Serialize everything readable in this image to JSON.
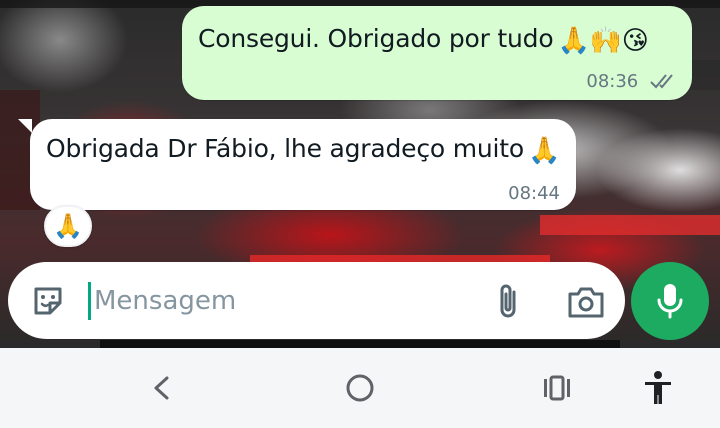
{
  "messages": [
    {
      "direction": "outgoing",
      "text": "Consegui. Obrigado por tudo",
      "emojis": "🙏🙌😘",
      "time": "08:36",
      "status": "read"
    },
    {
      "direction": "incoming",
      "text": "Obrigada Dr Fábio, lhe agradeço muito",
      "emojis": "🙏",
      "time": "08:44",
      "reaction": "🙏"
    }
  ],
  "composer": {
    "placeholder": "Mensagem",
    "value": ""
  },
  "icons": {
    "sticker": "sticker-icon",
    "attach": "paperclip-icon",
    "camera": "camera-icon",
    "mic": "microphone-icon",
    "nav_back": "back-chevron-icon",
    "nav_home": "home-circle-icon",
    "nav_recents": "recents-icon",
    "nav_accessibility": "accessibility-icon"
  },
  "colors": {
    "outgoing_bubble": "#d9fdd3",
    "incoming_bubble": "#ffffff",
    "accent_green": "#1daa61",
    "read_ticks": "#667781",
    "meta_text": "#667781"
  }
}
